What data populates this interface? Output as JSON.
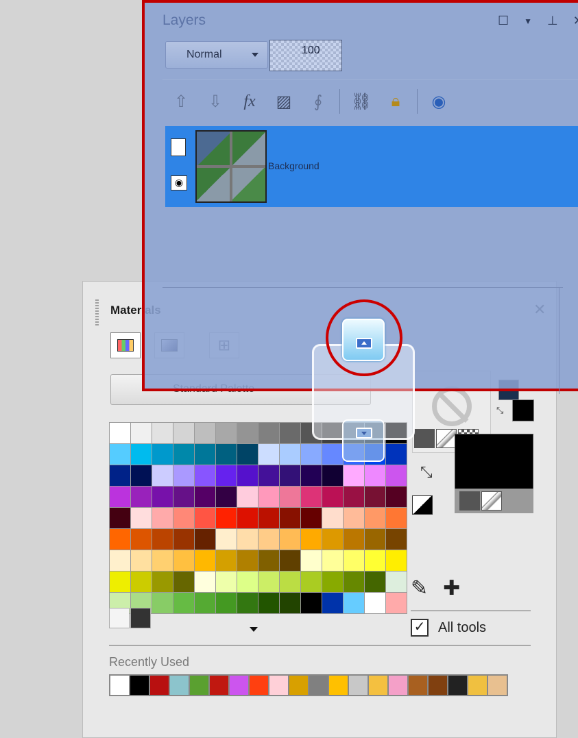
{
  "layers": {
    "title": "Layers",
    "blend_mode": "Normal",
    "opacity": "100",
    "layer_name": "Background"
  },
  "materials": {
    "title": "Materials",
    "palette_name": "Standard Palette",
    "recently_used_label": "Recently Used",
    "all_tools_label": "All tools",
    "all_tools_checked": true,
    "palette_rows": [
      [
        "#ffffff",
        "#f0f0f0",
        "#e2e2e2",
        "#d4d4d4",
        "#bebebe",
        "#a8a8a8",
        "#949494",
        "#808080",
        "#6a6a6a",
        "#565656",
        "#404040",
        "#2c2c2c",
        "#181818",
        "#000000"
      ],
      [
        "#55ccff",
        "#00bbee",
        "#0099cc",
        "#0088aa",
        "#007799",
        "#006080",
        "#004466",
        "#ccddff",
        "#aaccff",
        "#88aaff",
        "#6688ff",
        "#3366ff",
        "#0044ee",
        "#0033bb"
      ],
      [
        "#002288",
        "#001155",
        "#ccccff",
        "#aa99ff",
        "#8855ff",
        "#6622ee",
        "#5511cc",
        "#441199",
        "#331177",
        "#220055",
        "#110033",
        "#ffaaff",
        "#ee88ff",
        "#cc55ee"
      ],
      [
        "#bb33dd",
        "#9922bb",
        "#7711aa",
        "#661188",
        "#550066",
        "#330044",
        "#ffccdd",
        "#ff99bb",
        "#ee7799",
        "#dd3377",
        "#bb1155",
        "#991144",
        "#771133",
        "#550022"
      ],
      [
        "#440011",
        "#ffdddd",
        "#ffaaaa",
        "#ff8877",
        "#ff5544",
        "#ff2200",
        "#dd1100",
        "#bb1100",
        "#881100",
        "#660000",
        "#ffddcc",
        "#ffbb99",
        "#ff9966",
        "#ff7733"
      ],
      [
        "#ff6600",
        "#dd5500",
        "#bb4400",
        "#993300",
        "#662200",
        "#ffeecc",
        "#ffddaa",
        "#ffcc88",
        "#ffbb55",
        "#ffaa00",
        "#dd9900",
        "#bb7700",
        "#996600",
        "#774400"
      ],
      [
        "#fff0cc",
        "#ffe0a0",
        "#ffd070",
        "#ffc040",
        "#ffb800",
        "#d4a000",
        "#b08000",
        "#806000",
        "#604000",
        "#ffffcc",
        "#ffff99",
        "#ffff66",
        "#ffff33",
        "#ffee00"
      ],
      [
        "#eeee00",
        "#cccc00",
        "#999900",
        "#666600",
        "#ffffdd",
        "#eeffaa",
        "#ddff88",
        "#ccee66",
        "#bbdd44",
        "#aacc22",
        "#88aa00",
        "#668800",
        "#446600",
        "#ddeedd"
      ],
      [
        "#cceeaa",
        "#aadd88",
        "#88cc66",
        "#66bb44",
        "#55aa33",
        "#449922",
        "#337711",
        "#225500",
        "#224400",
        "#000000",
        "#0033aa",
        "#66ccff",
        "#ffffff",
        "#ffaaaa"
      ]
    ],
    "palette_last_row": [
      "#f4f4f4",
      "#333333"
    ],
    "recent_swatches": [
      "#ffffff",
      "#000000",
      "#b81010",
      "#8cc4cc",
      "#5aa030",
      "#c01810",
      "#cc55ee",
      "#ff4010",
      "#ffd0d8",
      "#d8a000",
      "#808080",
      "#ffc000",
      "#c8c8c8",
      "#f4c040",
      "#f4a0c8",
      "#a86020",
      "#804010",
      "#222222",
      "#f0c040",
      "#e8c090"
    ],
    "foreground_color": "#1a2f4e",
    "background_color": "#000000"
  }
}
